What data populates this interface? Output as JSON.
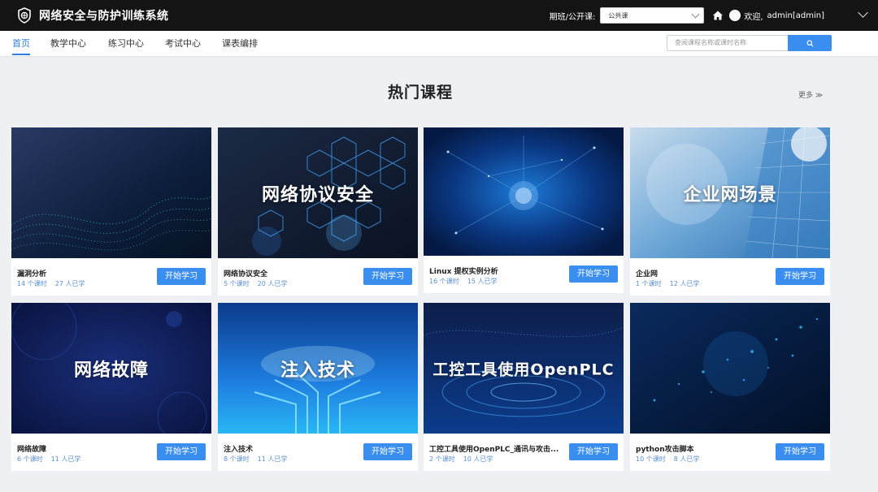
{
  "header": {
    "app_title": "网络安全与防护训练系统",
    "class_label": "期班/公开课:",
    "class_value": "公共课",
    "welcome": "欢迎,",
    "user_name": "admin[admin]"
  },
  "nav": {
    "items": [
      {
        "label": "首页",
        "active": true
      },
      {
        "label": "教学中心",
        "active": false
      },
      {
        "label": "练习中心",
        "active": false
      },
      {
        "label": "考试中心",
        "active": false
      },
      {
        "label": "课表编排",
        "active": false
      }
    ],
    "search_placeholder": "查阅课程名称或课时名称"
  },
  "section": {
    "title": "热门课程",
    "more": "更多 ≫"
  },
  "courses": [
    {
      "name": "漏洞分析",
      "lessons": "14 个课时",
      "learners": "27 人已学",
      "thumb_text": "",
      "button": "开始学习",
      "theme": "wave"
    },
    {
      "name": "网络协议安全",
      "lessons": "5 个课时",
      "learners": "20 人已学",
      "thumb_text": "网络协议安全",
      "button": "开始学习",
      "theme": "hex"
    },
    {
      "name": "Linux 提权实例分析",
      "lessons": "16 个课时",
      "learners": "15 人已学",
      "thumb_text": "",
      "button": "开始学习",
      "theme": "globe"
    },
    {
      "name": "企业网",
      "lessons": "1 个课时",
      "learners": "12 人已学",
      "thumb_text": "企业网场景",
      "button": "开始学习",
      "theme": "building"
    },
    {
      "name": "网络故障",
      "lessons": "6 个课时",
      "learners": "11 人已学",
      "thumb_text": "网络故障",
      "button": "开始学习",
      "theme": "dark"
    },
    {
      "name": "注入技术",
      "lessons": "8 个课时",
      "learners": "11 人已学",
      "thumb_text": "注入技术",
      "button": "开始学习",
      "theme": "circuit"
    },
    {
      "name": "工控工具使用OpenPLC_通讯与攻击...",
      "lessons": "2 个课时",
      "learners": "10 人已学",
      "thumb_text": "工控工具使用OpenPLC",
      "button": "开始学习",
      "theme": "rings"
    },
    {
      "name": "python攻击脚本",
      "lessons": "10 个课时",
      "learners": "8 人已学",
      "thumb_text": "",
      "button": "开始学习",
      "theme": "particles"
    }
  ]
}
